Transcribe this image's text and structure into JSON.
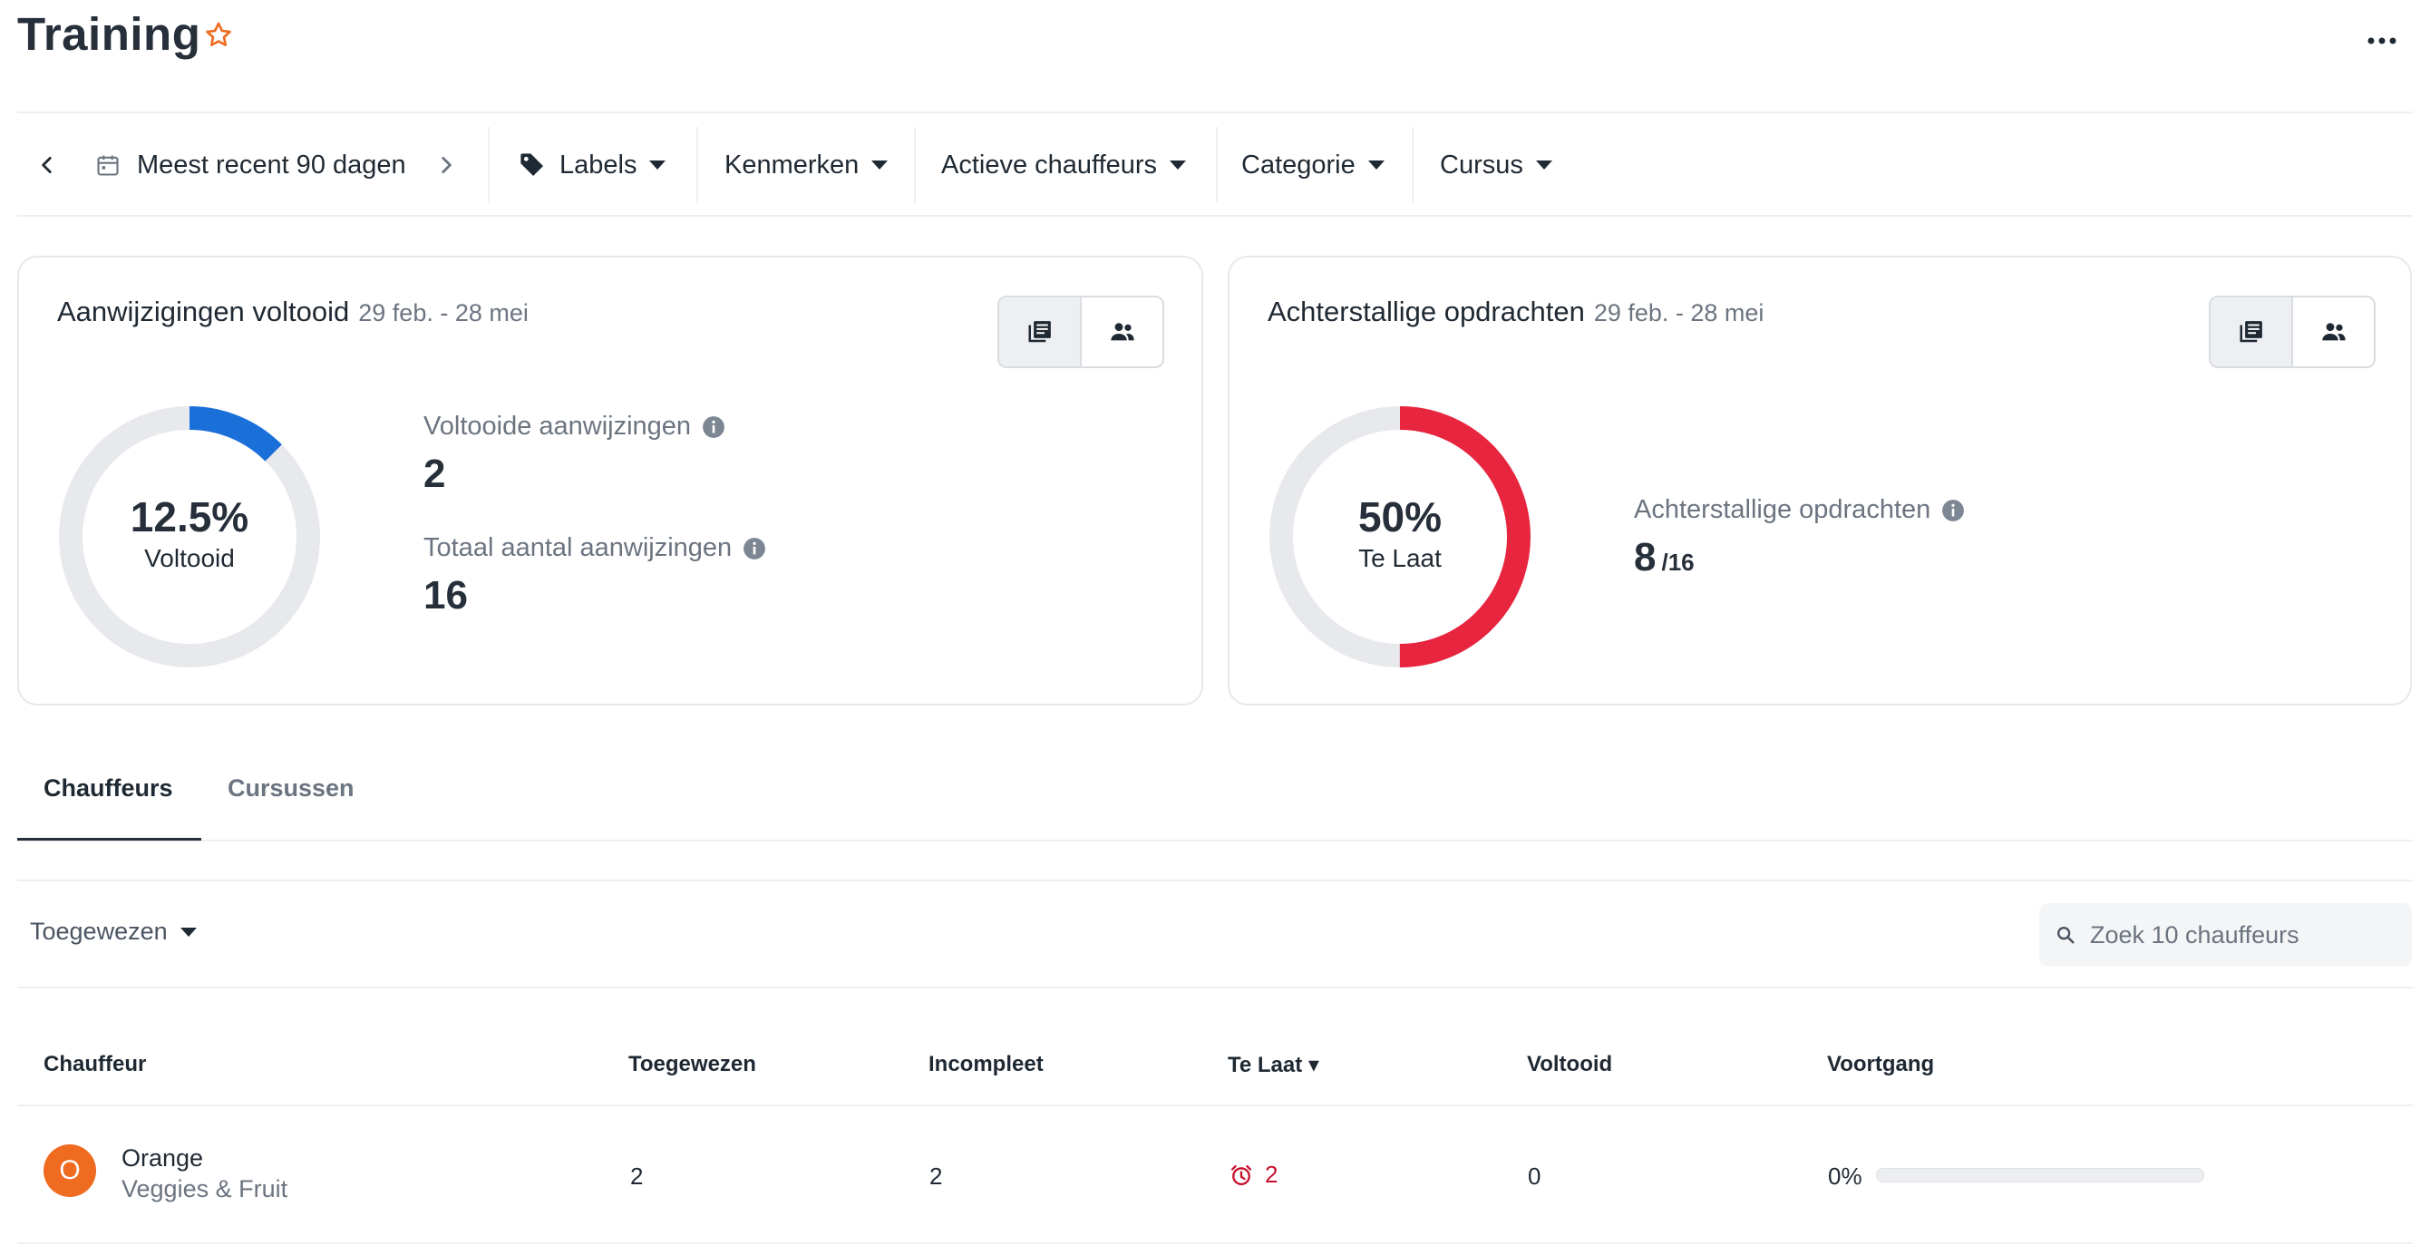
{
  "header": {
    "title": "Training",
    "star_icon": "star-outline-icon",
    "more_icon": "ellipsis-icon"
  },
  "filters": {
    "prev_icon": "chevron-left-icon",
    "calendar_icon": "calendar-icon",
    "date_range": "Meest recent 90 dagen",
    "next_icon": "chevron-right-icon",
    "labels": "Labels",
    "kenmerken": "Kenmerken",
    "actieve_chauffeurs": "Actieve chauffeurs",
    "categorie": "Categorie",
    "cursus": "Cursus"
  },
  "card_completed": {
    "title": "Aanwijzigingen voltooid",
    "range": "29 feb. - 28 mei",
    "donut_value": "12.5%",
    "donut_label": "Voltooid",
    "donut_fraction": 0.125,
    "metric1_label": "Voltooide aanwijzingen",
    "metric1_value": "2",
    "metric2_label": "Totaal aantal aanwijzingen",
    "metric2_value": "16"
  },
  "card_overdue": {
    "title": "Achterstallige opdrachten",
    "range": "29 feb. - 28 mei",
    "donut_value": "50%",
    "donut_label": "Te Laat",
    "donut_fraction": 0.5,
    "metric_label": "Achterstallige opdrachten",
    "metric_value": "8",
    "metric_total": "/16"
  },
  "tabs": {
    "chauffeurs": "Chauffeurs",
    "cursussen": "Cursussen"
  },
  "toolbar": {
    "assigned_filter": "Toegewezen",
    "search_placeholder": "Zoek 10 chauffeurs"
  },
  "table": {
    "headers": {
      "chauffeur": "Chauffeur",
      "toegewezen": "Toegewezen",
      "incompleet": "Incompleet",
      "te_laat": "Te Laat ▾",
      "voltooid": "Voltooid",
      "voortgang": "Voortgang"
    },
    "rows": [
      {
        "avatar_letter": "O",
        "name": "Orange",
        "group": "Veggies & Fruit",
        "toegewezen": "2",
        "incompleet": "2",
        "te_laat": "2",
        "voltooid": "0",
        "voortgang": "0%",
        "progress": 0
      }
    ]
  },
  "colors": {
    "accent_blue": "#1a6fd8",
    "overdue_red": "#e8253e",
    "star_orange": "#ee6b1f",
    "avatar_orange": "#ee6b1f",
    "late_text_red": "#c8102e",
    "donut_track": "#e8e9ec"
  }
}
